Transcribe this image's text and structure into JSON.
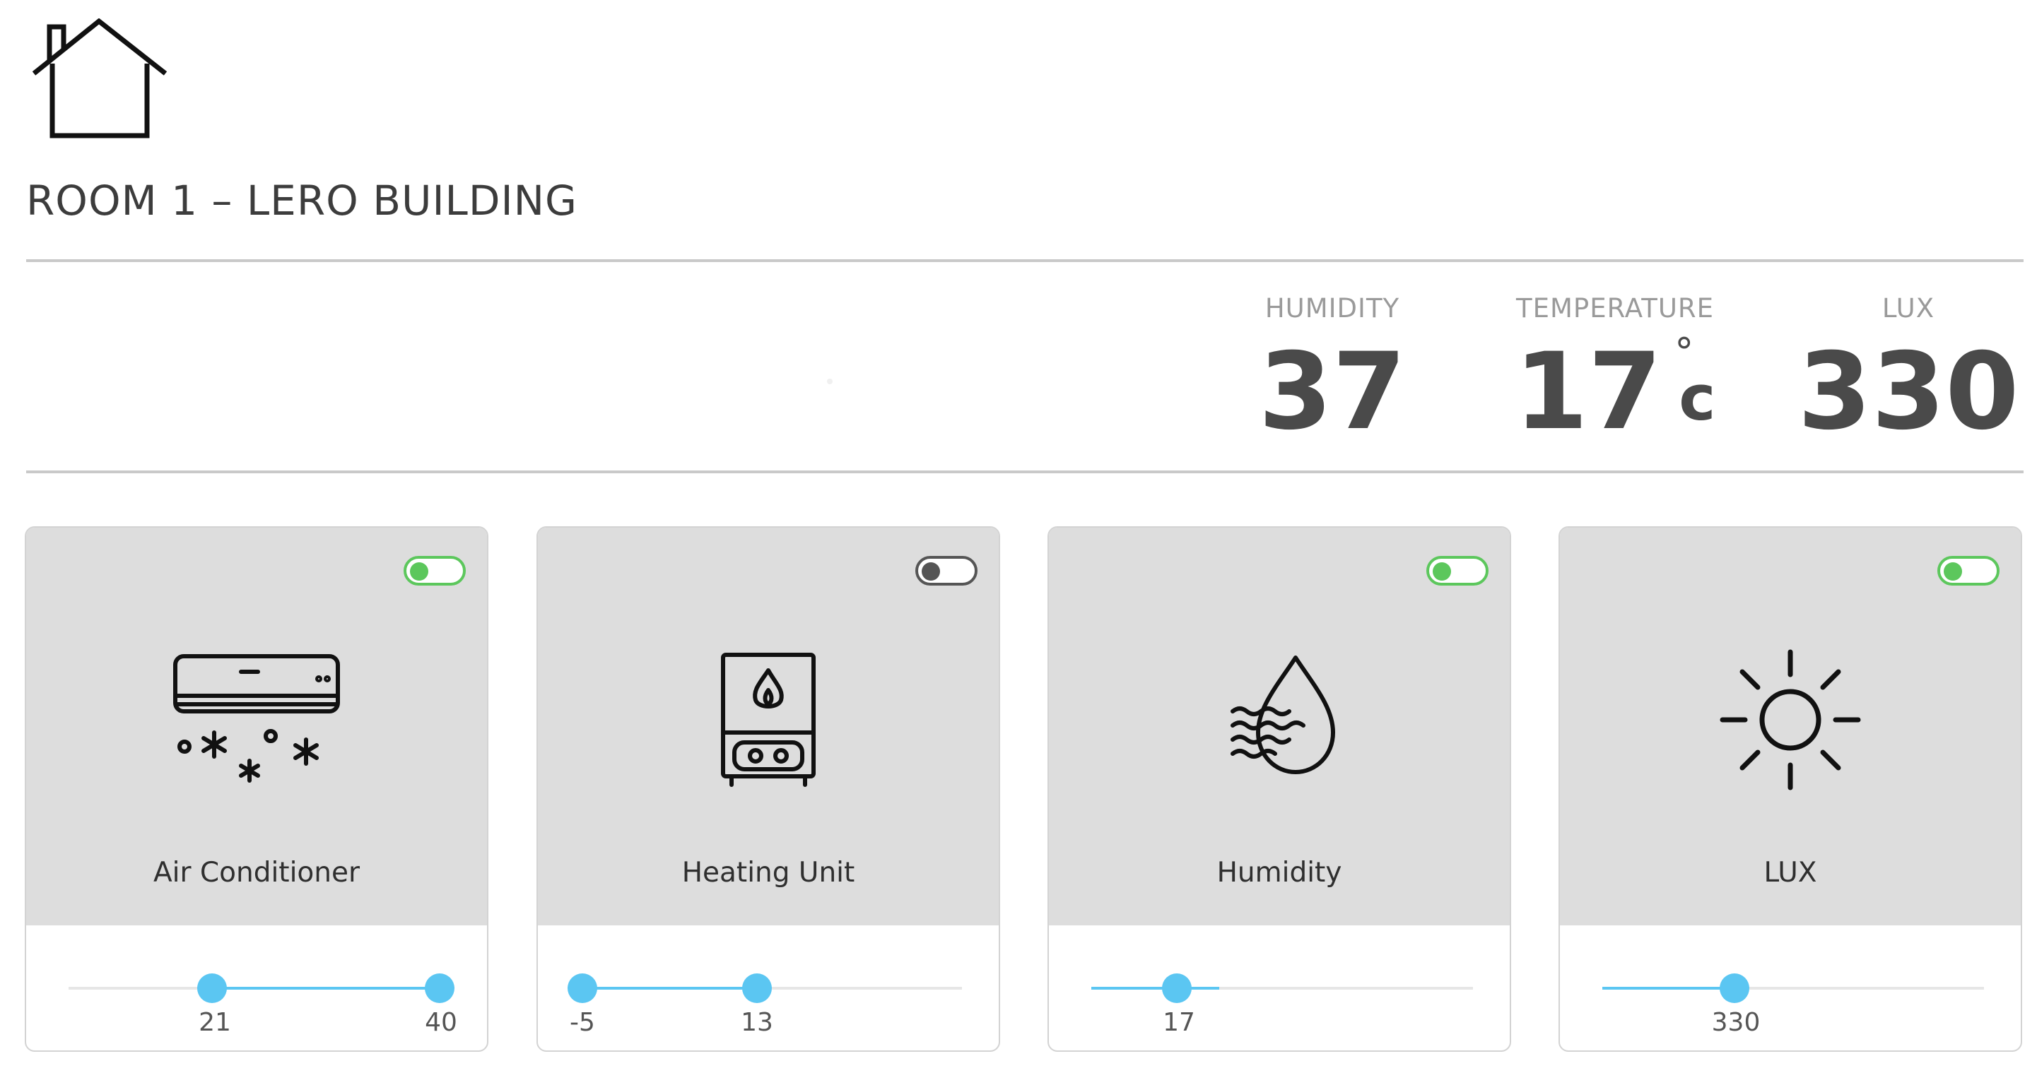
{
  "header": {
    "icon": "home-icon",
    "title": "ROOM 1 – LERO BUILDING"
  },
  "readings": {
    "humidity": {
      "label": "HUMIDITY",
      "value": "37"
    },
    "temperature": {
      "label": "TEMPERATURE",
      "value": "17",
      "unit_degree": "°",
      "unit": "c"
    },
    "lux": {
      "label": "LUX",
      "value": "330"
    }
  },
  "colors": {
    "toggle_on": "#5cc75c",
    "toggle_off": "#555555",
    "slider": "#5bc6f2",
    "card_bg": "#dddddd"
  },
  "devices": [
    {
      "name": "Air Conditioner",
      "icon": "air-conditioner-icon",
      "enabled": true,
      "slider": {
        "type": "range",
        "low": "21",
        "high": "40"
      }
    },
    {
      "name": "Heating Unit",
      "icon": "heater-icon",
      "enabled": false,
      "slider": {
        "type": "range",
        "low": "-5",
        "high": "13"
      }
    },
    {
      "name": "Humidity",
      "icon": "humidity-drop-icon",
      "enabled": true,
      "slider": {
        "type": "single",
        "value": "17"
      }
    },
    {
      "name": "LUX",
      "icon": "sun-icon",
      "enabled": true,
      "slider": {
        "type": "single",
        "value": "330"
      }
    }
  ]
}
